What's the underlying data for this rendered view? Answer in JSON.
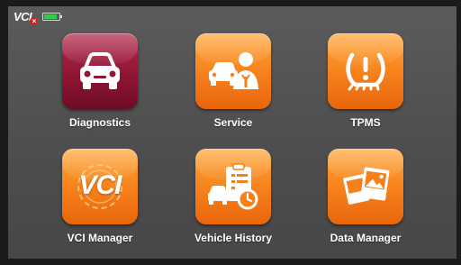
{
  "status_bar": {
    "vci_label": "VCI",
    "vci_disconnected_mark": "×",
    "battery_level": 0.85
  },
  "colors": {
    "tile_orange": "#f6801a",
    "tile_maroon": "#8e1634",
    "screen_bg": "#555555",
    "battery_green": "#39c94a"
  },
  "apps": [
    {
      "id": "diagnostics",
      "label": "Diagnostics",
      "icon": "car-front-icon"
    },
    {
      "id": "service",
      "label": "Service",
      "icon": "car-mechanic-icon"
    },
    {
      "id": "tpms",
      "label": "TPMS",
      "icon": "tire-pressure-warning-icon"
    },
    {
      "id": "vci-manager",
      "label": "VCI Manager",
      "icon": "vci-gear-icon",
      "icon_text": "VCI"
    },
    {
      "id": "vehicle-history",
      "label": "Vehicle History",
      "icon": "car-history-clipboard-icon"
    },
    {
      "id": "data-manager",
      "label": "Data Manager",
      "icon": "image-files-icon"
    }
  ]
}
